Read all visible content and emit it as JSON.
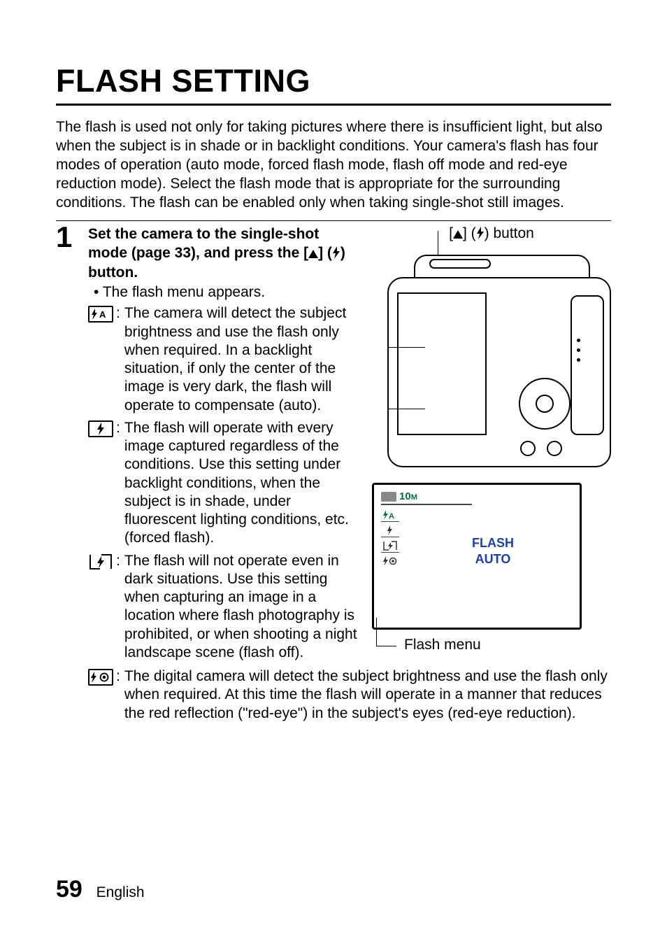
{
  "title": "FLASH SETTING",
  "intro": "The flash is used not only for taking pictures where there is insufficient light, but also when the subject is in shade or in backlight conditions. Your camera's flash has four modes of operation (auto mode, forced flash mode, flash off mode and red-eye reduction mode). Select the flash mode that is appropriate for the surrounding conditions. The flash can be enabled only when taking single-shot still images.",
  "step": {
    "number": "1",
    "head_a": "Set the camera to the single-shot mode (page 33), and press the [",
    "head_b": "] (",
    "head_c": ") button.",
    "bullet": "The flash menu appears.",
    "modes": {
      "auto": "The camera will detect the subject brightness and use the flash only when required. In a backlight situation, if only the center of the image is very dark, the flash will operate to compensate (auto).",
      "forced": "The flash will operate with every image captured regardless of the conditions. Use this setting under backlight conditions, when the subject is in shade, under fluorescent lighting conditions, etc. (forced flash).",
      "off": "The flash will not operate even in dark situations. Use this setting when capturing an image in a location where flash photography is prohibited, or when shooting a night landscape scene (flash off).",
      "redeye": "The digital camera will detect the subject brightness and use the flash only when required. At this time the flash will operate in a manner that reduces the red reflection (\"red-eye\") in the subject's eyes (red-eye reduction)."
    }
  },
  "diagram": {
    "button_label_a": "[",
    "button_label_b": "] (",
    "button_label_c": ") button",
    "screen_resolution": "10",
    "screen_resolution_suffix": "M",
    "screen_label_line1": "FLASH",
    "screen_label_line2": "AUTO",
    "flash_menu_label": "Flash menu"
  },
  "footer": {
    "page": "59",
    "lang": "English"
  }
}
